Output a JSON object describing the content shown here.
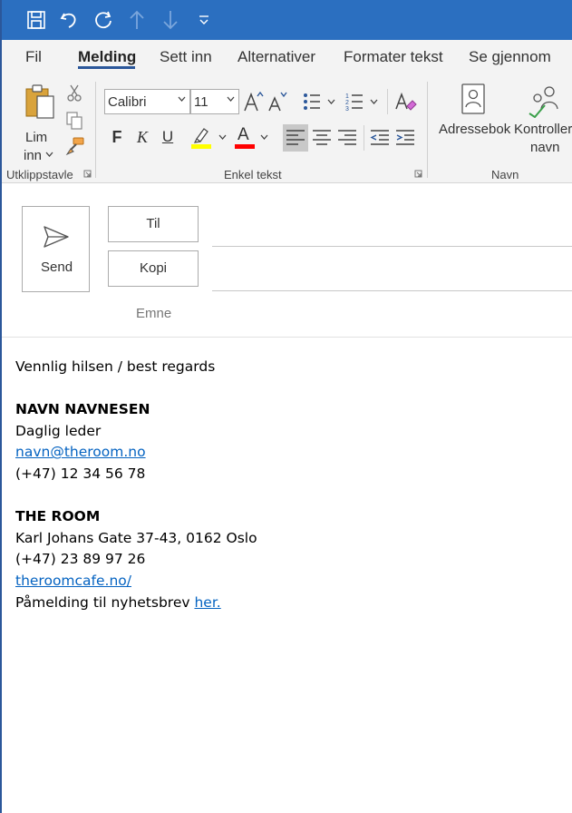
{
  "quick_access": {
    "icons": [
      "save-icon",
      "undo-icon",
      "redo-icon",
      "up-arrow-icon",
      "down-arrow-icon",
      "customize-icon"
    ]
  },
  "tabs": [
    "Fil",
    "Melding",
    "Sett inn",
    "Alternativer",
    "Formater tekst",
    "Se gjennom"
  ],
  "active_tab": "Melding",
  "ribbon": {
    "clipboard": {
      "paste_label_1": "Lim",
      "paste_label_2": "inn",
      "group_label": "Utklippstavle"
    },
    "basic_text": {
      "font_name": "Calibri",
      "font_size": "11",
      "bold_label": "F",
      "italic_label": "K",
      "underline_label": "U",
      "font_color_label": "A",
      "group_label": "Enkel tekst",
      "highlight_color": "#ffff00",
      "font_color": "#ff0000"
    },
    "names": {
      "address_book_label": "Adressebok",
      "check_names_label_1": "Kontroller",
      "check_names_label_2": "navn",
      "group_label": "Navn"
    }
  },
  "compose": {
    "send_label": "Send",
    "to_label": "Til",
    "cc_label": "Kopi",
    "subject_label": "Emne"
  },
  "message_body": {
    "greeting": "Vennlig hilsen / best regards",
    "name": "NAVN NAVNESEN",
    "role": "Daglig leder",
    "email": "navn@theroom.no",
    "phone": "(+47) 12 34 56 78",
    "company": "THE ROOM",
    "address": "Karl Johans Gate 37-43, 0162 Oslo",
    "company_phone": "(+47) 23 89 97 26",
    "website": "theroomcafe.no/",
    "newsletter_text": "Påmelding til nyhetsbrev ",
    "newsletter_link": "her."
  },
  "colors": {
    "titlebar": "#2b6fc0",
    "accent": "#2b579a",
    "link": "#0563c1"
  }
}
